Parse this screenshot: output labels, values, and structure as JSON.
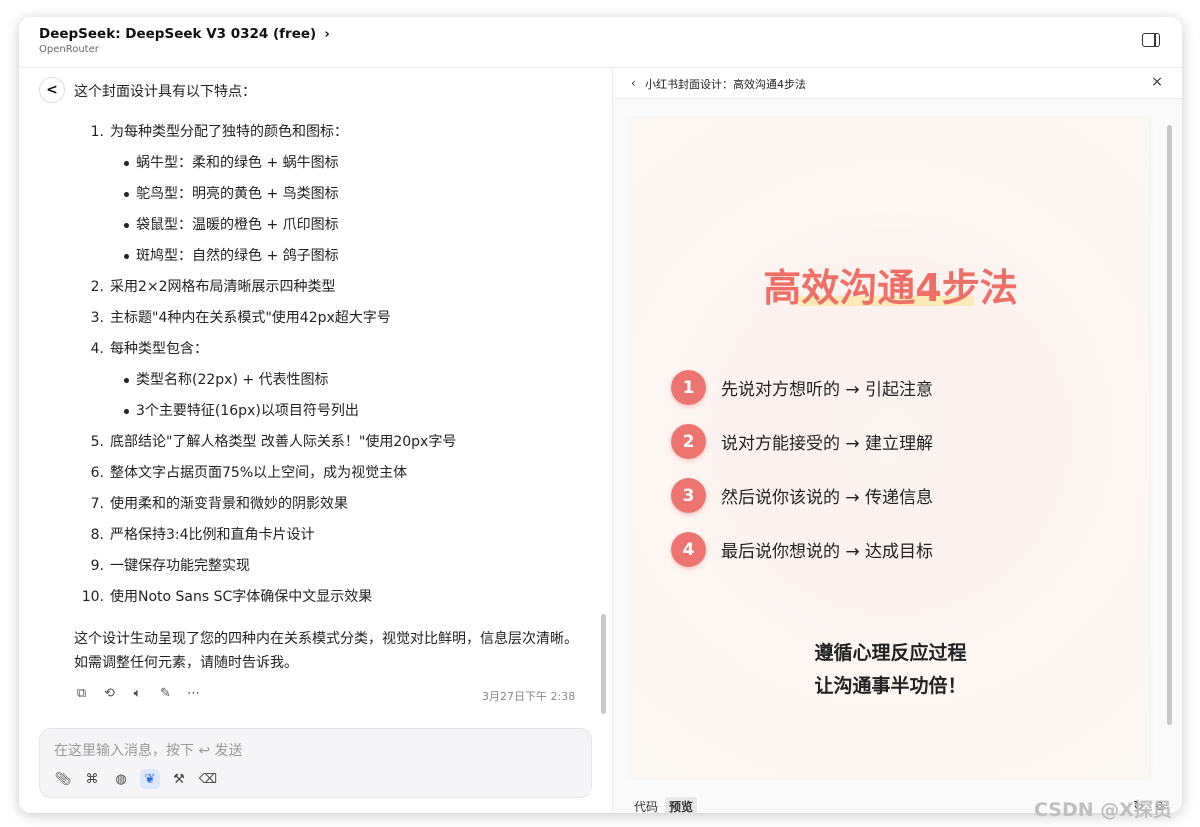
{
  "header": {
    "model_title": "DeepSeek: DeepSeek V3 0324 (free)",
    "model_provider": "OpenRouter"
  },
  "chat": {
    "avatar": "<",
    "intro": "这个封面设计具有以下特点：",
    "list": [
      {
        "num": "1.",
        "text": "为每种类型分配了独特的颜色和图标："
      },
      {
        "num": "",
        "text": "蜗牛型：柔和的绿色 + 蜗牛图标",
        "sub": true
      },
      {
        "num": "",
        "text": "鸵鸟型：明亮的黄色 + 鸟类图标",
        "sub": true
      },
      {
        "num": "",
        "text": "袋鼠型：温暖的橙色 + 爪印图标",
        "sub": true
      },
      {
        "num": "",
        "text": "斑鸠型：自然的绿色 + 鸽子图标",
        "sub": true
      },
      {
        "num": "2.",
        "text": "采用2×2网格布局清晰展示四种类型"
      },
      {
        "num": "3.",
        "text": "主标题\"4种内在关系模式\"使用42px超大字号"
      },
      {
        "num": "4.",
        "text": "每种类型包含："
      },
      {
        "num": "",
        "text": "类型名称(22px) + 代表性图标",
        "sub": true
      },
      {
        "num": "",
        "text": "3个主要特征(16px)以项目符号列出",
        "sub": true
      },
      {
        "num": "5.",
        "text": "底部结论\"了解人格类型 改善人际关系！\"使用20px字号"
      },
      {
        "num": "6.",
        "text": "整体文字占据页面75%以上空间，成为视觉主体"
      },
      {
        "num": "7.",
        "text": "使用柔和的渐变背景和微妙的阴影效果"
      },
      {
        "num": "8.",
        "text": "严格保持3:4比例和直角卡片设计"
      },
      {
        "num": "9.",
        "text": "一键保存功能完整实现"
      },
      {
        "num": "10.",
        "text": "使用Noto Sans SC字体确保中文显示效果"
      }
    ],
    "summary": "这个设计生动呈现了您的四种内在关系模式分类，视觉对比鲜明，信息层次清晰。如需调整任何元素，请随时告诉我。",
    "timestamp": "3月27日下午 2:38",
    "input_placeholder": "在这里输入消息，按下 ↩ 发送"
  },
  "preview": {
    "title": "小红书封面设计：高效沟通4步法",
    "card_title": "高效沟通4步法",
    "steps": [
      {
        "n": "1",
        "text": "先说对方想听的 → 引起注意"
      },
      {
        "n": "2",
        "text": "说对方能接受的 → 建立理解"
      },
      {
        "n": "3",
        "text": "然后说你该说的 → 传递信息"
      },
      {
        "n": "4",
        "text": "最后说你想说的 → 达成目标"
      }
    ],
    "closing_line1": "遵循心理反应过程",
    "closing_line2": "让沟通事半功倍！",
    "tab_code": "代码",
    "tab_preview": "预览"
  },
  "watermark": "CSDN @X探员",
  "colors": {
    "accent": "#ee6f66",
    "badge": "#ee7470",
    "highlight": "#fde7a9",
    "active_tool": "#2d6bef"
  }
}
